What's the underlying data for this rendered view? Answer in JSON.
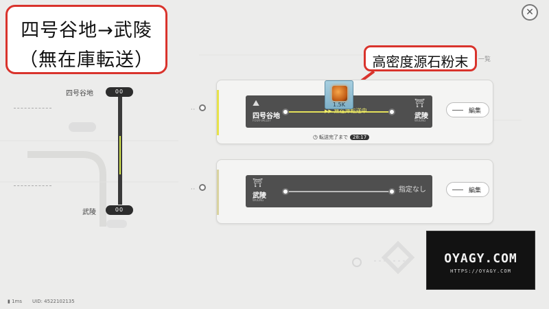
{
  "callout": {
    "title_line1": "四号谷地→武陵",
    "title_line2": "（無在庫転送）",
    "item_name": "高密度源石粉末"
  },
  "header": {
    "list_title": "一覧",
    "close_icon": "close-icon"
  },
  "route_map": {
    "top_node": {
      "label": "四号谷地",
      "pill": "00"
    },
    "bottom_node": {
      "label": "武陵",
      "pill": "00"
    }
  },
  "cards": [
    {
      "from": {
        "name": "四号谷地",
        "sub": "FOUR-VALLEY"
      },
      "to": {
        "name": "武陵",
        "sub": "WULING"
      },
      "status_label": "無在庫転送中",
      "edit_label": "編集",
      "timer_label": "転送完了まで",
      "timer_value": "28:17",
      "item": {
        "quantity": "1.5K",
        "icon": "origin-stone-powder-icon"
      },
      "accent_color": "#e7e24a"
    },
    {
      "from": {
        "name": "武陵",
        "sub": "WULING"
      },
      "to_label": "指定なし",
      "edit_label": "編集",
      "accent_color": "#d9d3a0"
    }
  ],
  "watermark": {
    "title": "OYAGY.COM",
    "url": "HTTPS://OYAGY.COM"
  },
  "footer": {
    "ping": "1ms",
    "uid": "UID: 4522102135"
  }
}
